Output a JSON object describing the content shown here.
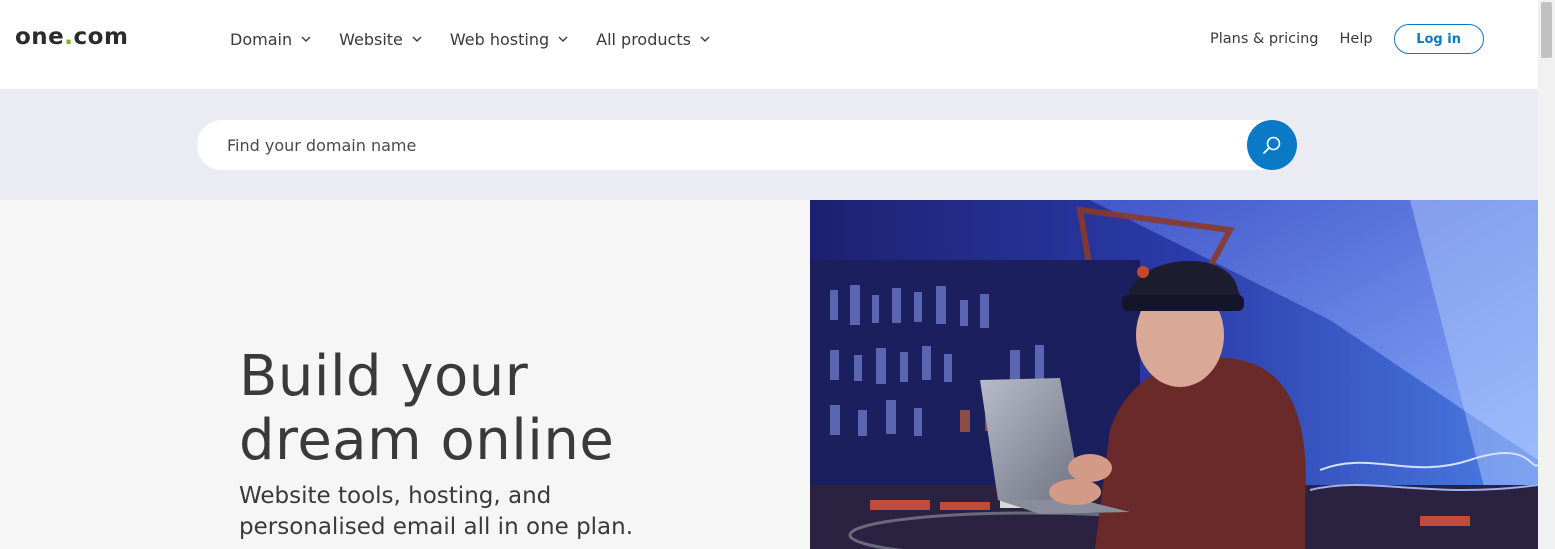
{
  "header": {
    "logo_prefix": "one",
    "logo_dot": ".",
    "logo_suffix": "com",
    "nav": [
      {
        "label": "Domain"
      },
      {
        "label": "Website"
      },
      {
        "label": "Web hosting"
      },
      {
        "label": "All products"
      }
    ],
    "plans_label": "Plans & pricing",
    "help_label": "Help",
    "login_label": "Log in"
  },
  "search": {
    "placeholder": "Find your domain name",
    "value": ""
  },
  "hero": {
    "title_line1": "Build your",
    "title_line2": "dream online",
    "subtitle_line1": "Website tools, hosting, and",
    "subtitle_line2": "personalised email all in one plan."
  },
  "colors": {
    "brand_blue": "#0a7ac6",
    "logo_dot_green": "#76b82a",
    "search_band": "#ebebf4",
    "hero_bg": "#f6f6f6"
  },
  "icons": {
    "search": "search-icon",
    "chevron": "chevron-down-icon"
  }
}
